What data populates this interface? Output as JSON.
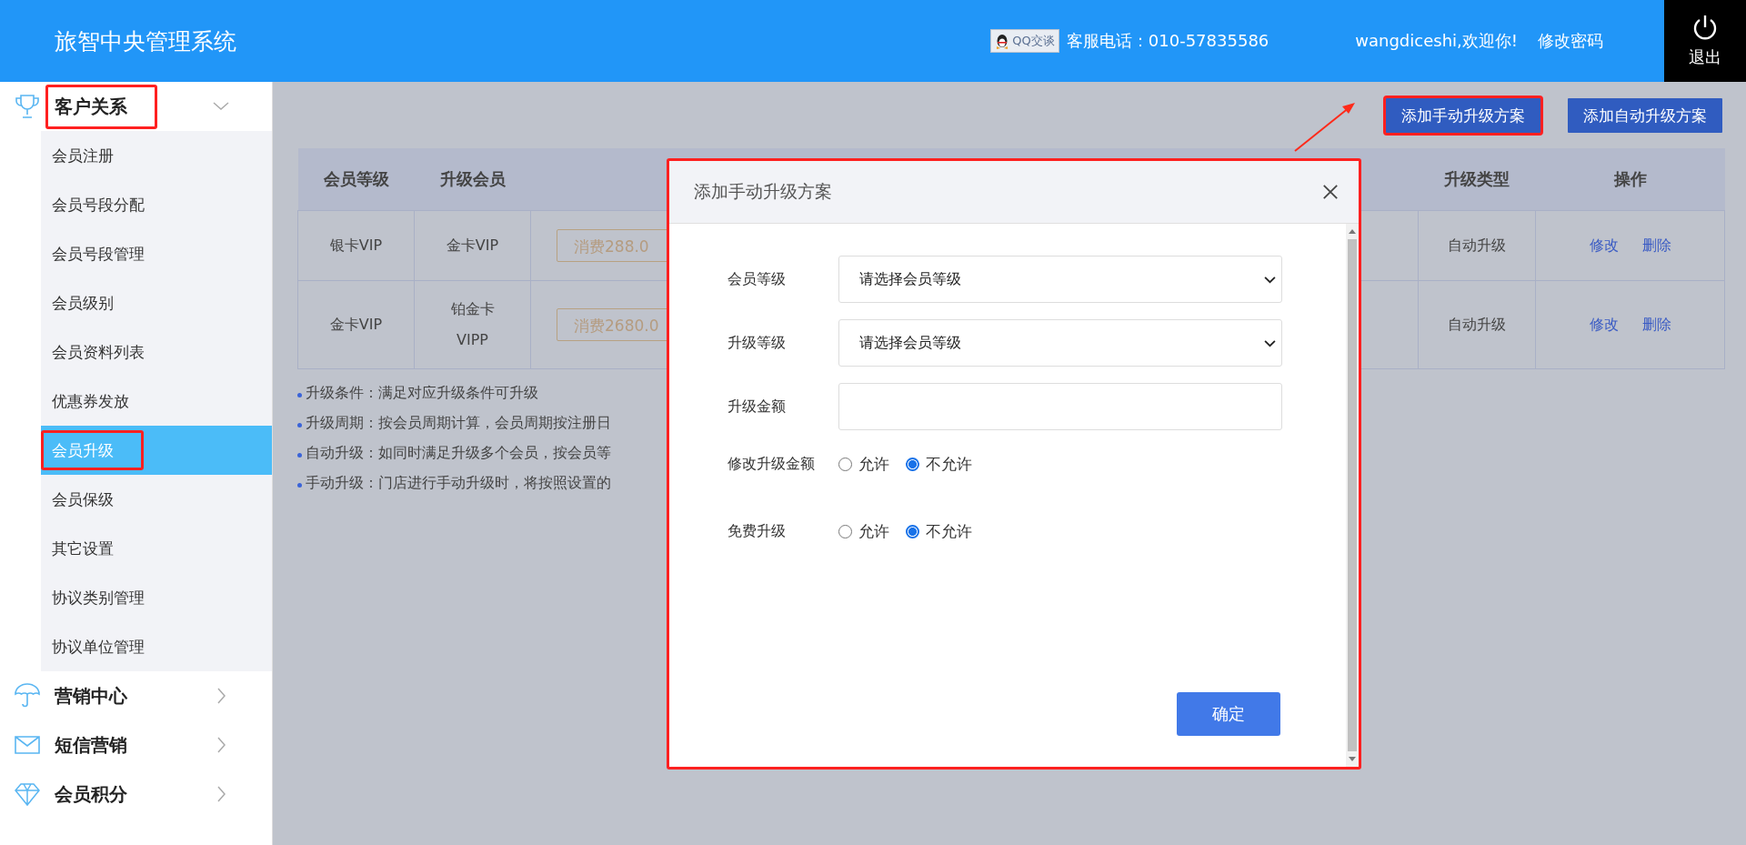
{
  "header": {
    "title": "旅智中央管理系统",
    "qq_button": "QQ交谈",
    "hotline": "客服电话：010-57835586",
    "welcome": "wangdiceshi,欢迎你!",
    "change_password": "修改密码",
    "logout": "退出"
  },
  "sidebar": {
    "groups": [
      {
        "label": "客户关系",
        "expanded": true,
        "highlighted": true,
        "children": [
          {
            "label": "会员注册",
            "selected": false,
            "highlighted": false
          },
          {
            "label": "会员号段分配",
            "selected": false,
            "highlighted": false
          },
          {
            "label": "会员号段管理",
            "selected": false,
            "highlighted": false
          },
          {
            "label": "会员级别",
            "selected": false,
            "highlighted": false
          },
          {
            "label": "会员资料列表",
            "selected": false,
            "highlighted": false
          },
          {
            "label": "优惠券发放",
            "selected": false,
            "highlighted": false
          },
          {
            "label": "会员升级",
            "selected": true,
            "highlighted": true
          },
          {
            "label": "会员保级",
            "selected": false,
            "highlighted": false
          },
          {
            "label": "其它设置",
            "selected": false,
            "highlighted": false
          },
          {
            "label": "协议类别管理",
            "selected": false,
            "highlighted": false
          },
          {
            "label": "协议单位管理",
            "selected": false,
            "highlighted": false
          }
        ]
      },
      {
        "label": "营销中心",
        "expanded": false,
        "highlighted": false
      },
      {
        "label": "短信营销",
        "expanded": false,
        "highlighted": false
      },
      {
        "label": "会员积分",
        "expanded": false,
        "highlighted": false
      }
    ]
  },
  "toolbar": {
    "buttons": [
      {
        "label": "添加手动升级方案",
        "highlighted": true
      },
      {
        "label": "添加自动升级方案",
        "highlighted": false
      }
    ]
  },
  "table": {
    "columns": {
      "level": "会员等级",
      "upgrade_to": "升级会员",
      "type": "升级类型",
      "actions": "操作"
    },
    "rows": [
      {
        "level": "银卡VIP",
        "upgrade_to": "金卡VIP",
        "condition": "消费288.0",
        "type": "自动升级",
        "actions": [
          "修改",
          "删除"
        ]
      },
      {
        "level": "金卡VIP",
        "upgrade_to": "铂金卡VIPP",
        "condition": "消费2680.0",
        "type": "自动升级",
        "actions": [
          "修改",
          "删除"
        ]
      }
    ]
  },
  "notes": [
    "升级条件：满足对应升级条件可升级",
    "升级周期：按会员周期计算，会员周期按注册日",
    "自动升级：如同时满足升级多个会员，按会员等",
    "手动升级：门店进行手动升级时，将按照设置的"
  ],
  "dialog": {
    "title": "添加手动升级方案",
    "highlighted": true,
    "fields": [
      {
        "kind": "select",
        "label": "会员等级",
        "value": "请选择会员等级"
      },
      {
        "kind": "select",
        "label": "升级等级",
        "value": "请选择会员等级"
      },
      {
        "kind": "text",
        "label": "升级金额"
      },
      {
        "kind": "radio",
        "label": "修改升级金额",
        "options": [
          {
            "label": "允许",
            "selected": false
          },
          {
            "label": "不允许",
            "selected": true
          }
        ]
      },
      {
        "kind": "radio",
        "label": "免费升级",
        "options": [
          {
            "label": "允许",
            "selected": false
          },
          {
            "label": "不允许",
            "selected": true
          }
        ]
      }
    ],
    "confirm": "确定"
  }
}
